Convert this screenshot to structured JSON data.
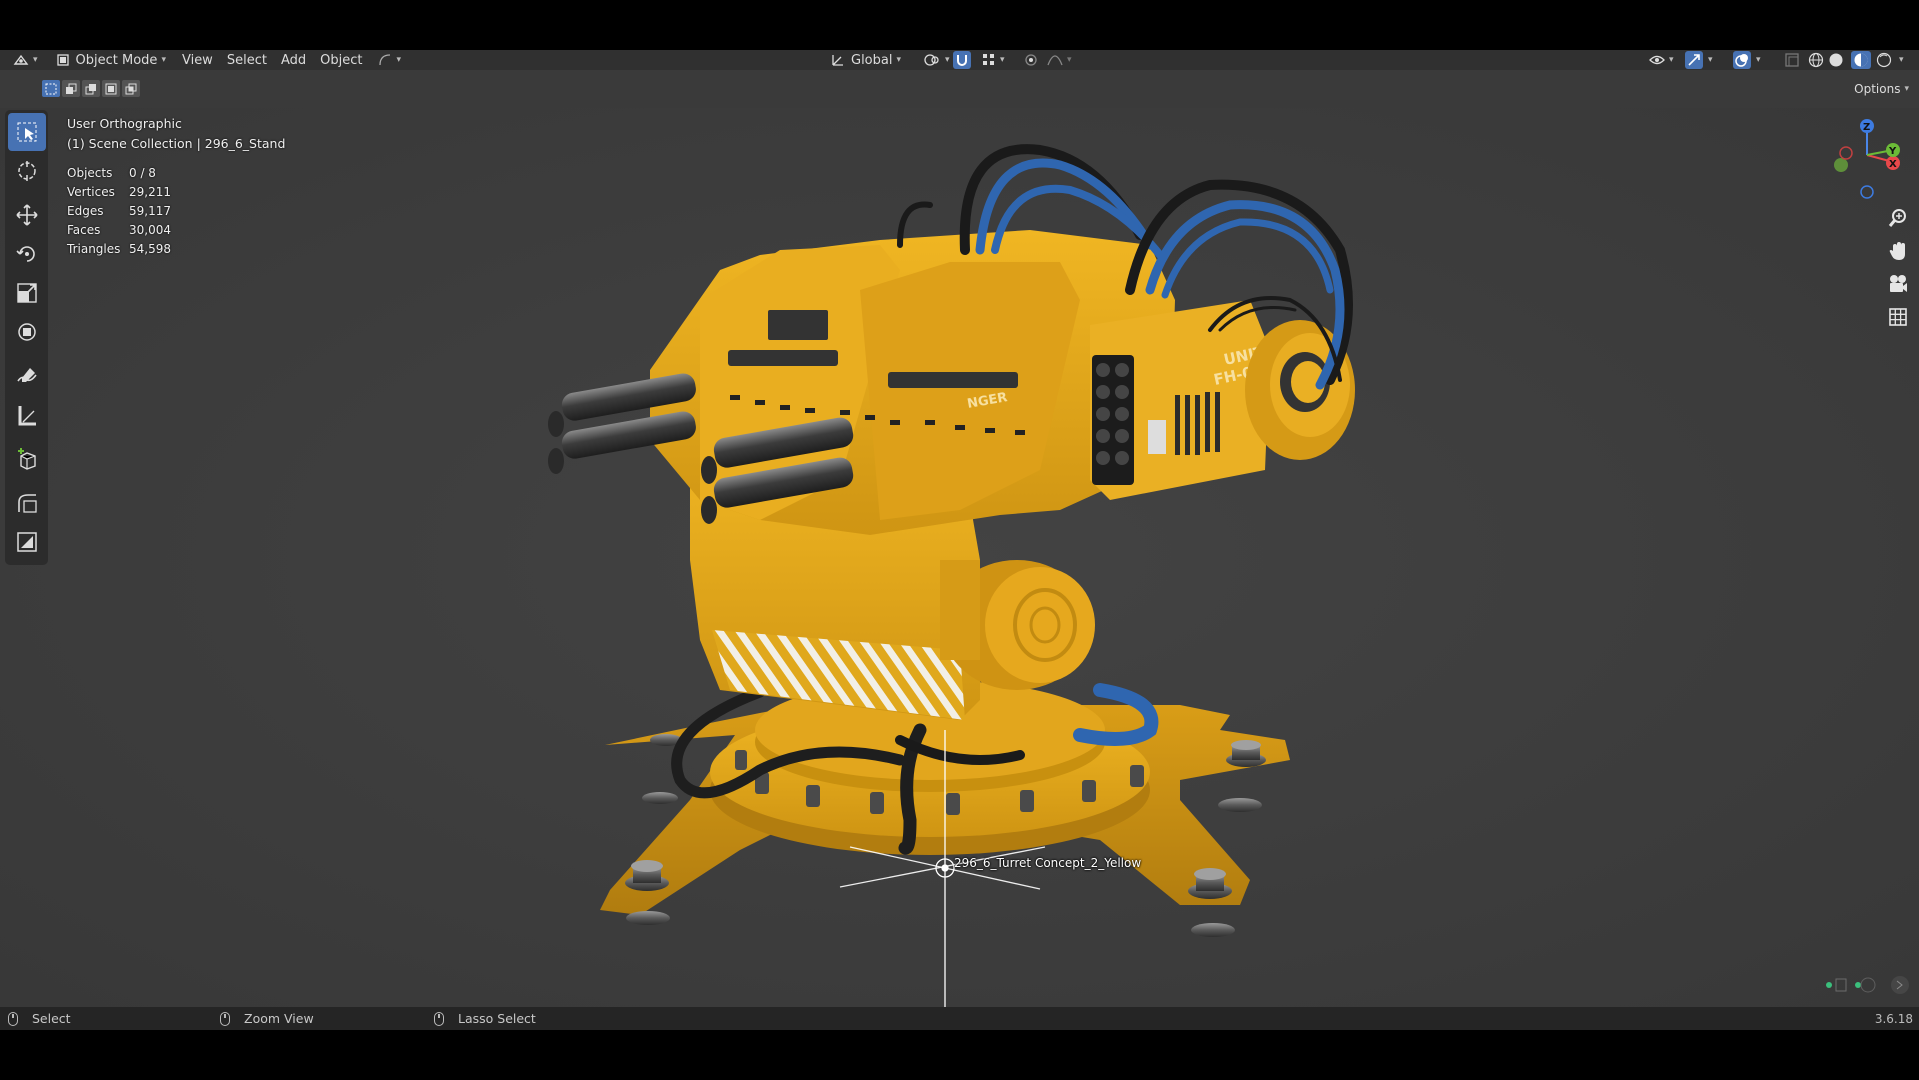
{
  "header": {
    "mode_label": "Object Mode",
    "menus": [
      "View",
      "Select",
      "Add",
      "Object"
    ],
    "transform_orientation": "Global"
  },
  "subheader": {
    "options_label": "Options"
  },
  "viewport": {
    "view_name": "User Orthographic",
    "collection_info": "(1) Scene Collection | 296_6_Stand",
    "stats": [
      {
        "label": "Objects",
        "value": "0 / 8"
      },
      {
        "label": "Vertices",
        "value": "29,211"
      },
      {
        "label": "Edges",
        "value": "59,117"
      },
      {
        "label": "Faces",
        "value": "30,004"
      },
      {
        "label": "Triangles",
        "value": "54,598"
      }
    ],
    "object_label": "296_6_Turret Concept_2_Yellow",
    "decal_text_1": "UNIT",
    "decal_text_2": "FH-019",
    "decal_text_3": "NGER"
  },
  "gizmo": {
    "axis_z": "Z",
    "axis_x": "X",
    "axis_y": "Y"
  },
  "toolbar_icons": [
    "select-box-icon",
    "cursor-icon",
    "move-icon",
    "rotate-icon",
    "scale-icon",
    "transform-icon",
    "annotate-icon",
    "measure-icon",
    "add-cube-icon",
    "shear-icon",
    "extrude-icon"
  ],
  "statusbar": {
    "left_label": "Select",
    "middle_label": "Zoom View",
    "right_label": "Lasso Select",
    "version": "3.6.18"
  },
  "colors": {
    "accent": "#4772b3",
    "viewport_bg": "#3c3c3c",
    "turret_yellow": "#e3a81c",
    "cable_blue": "#2f66b0"
  }
}
